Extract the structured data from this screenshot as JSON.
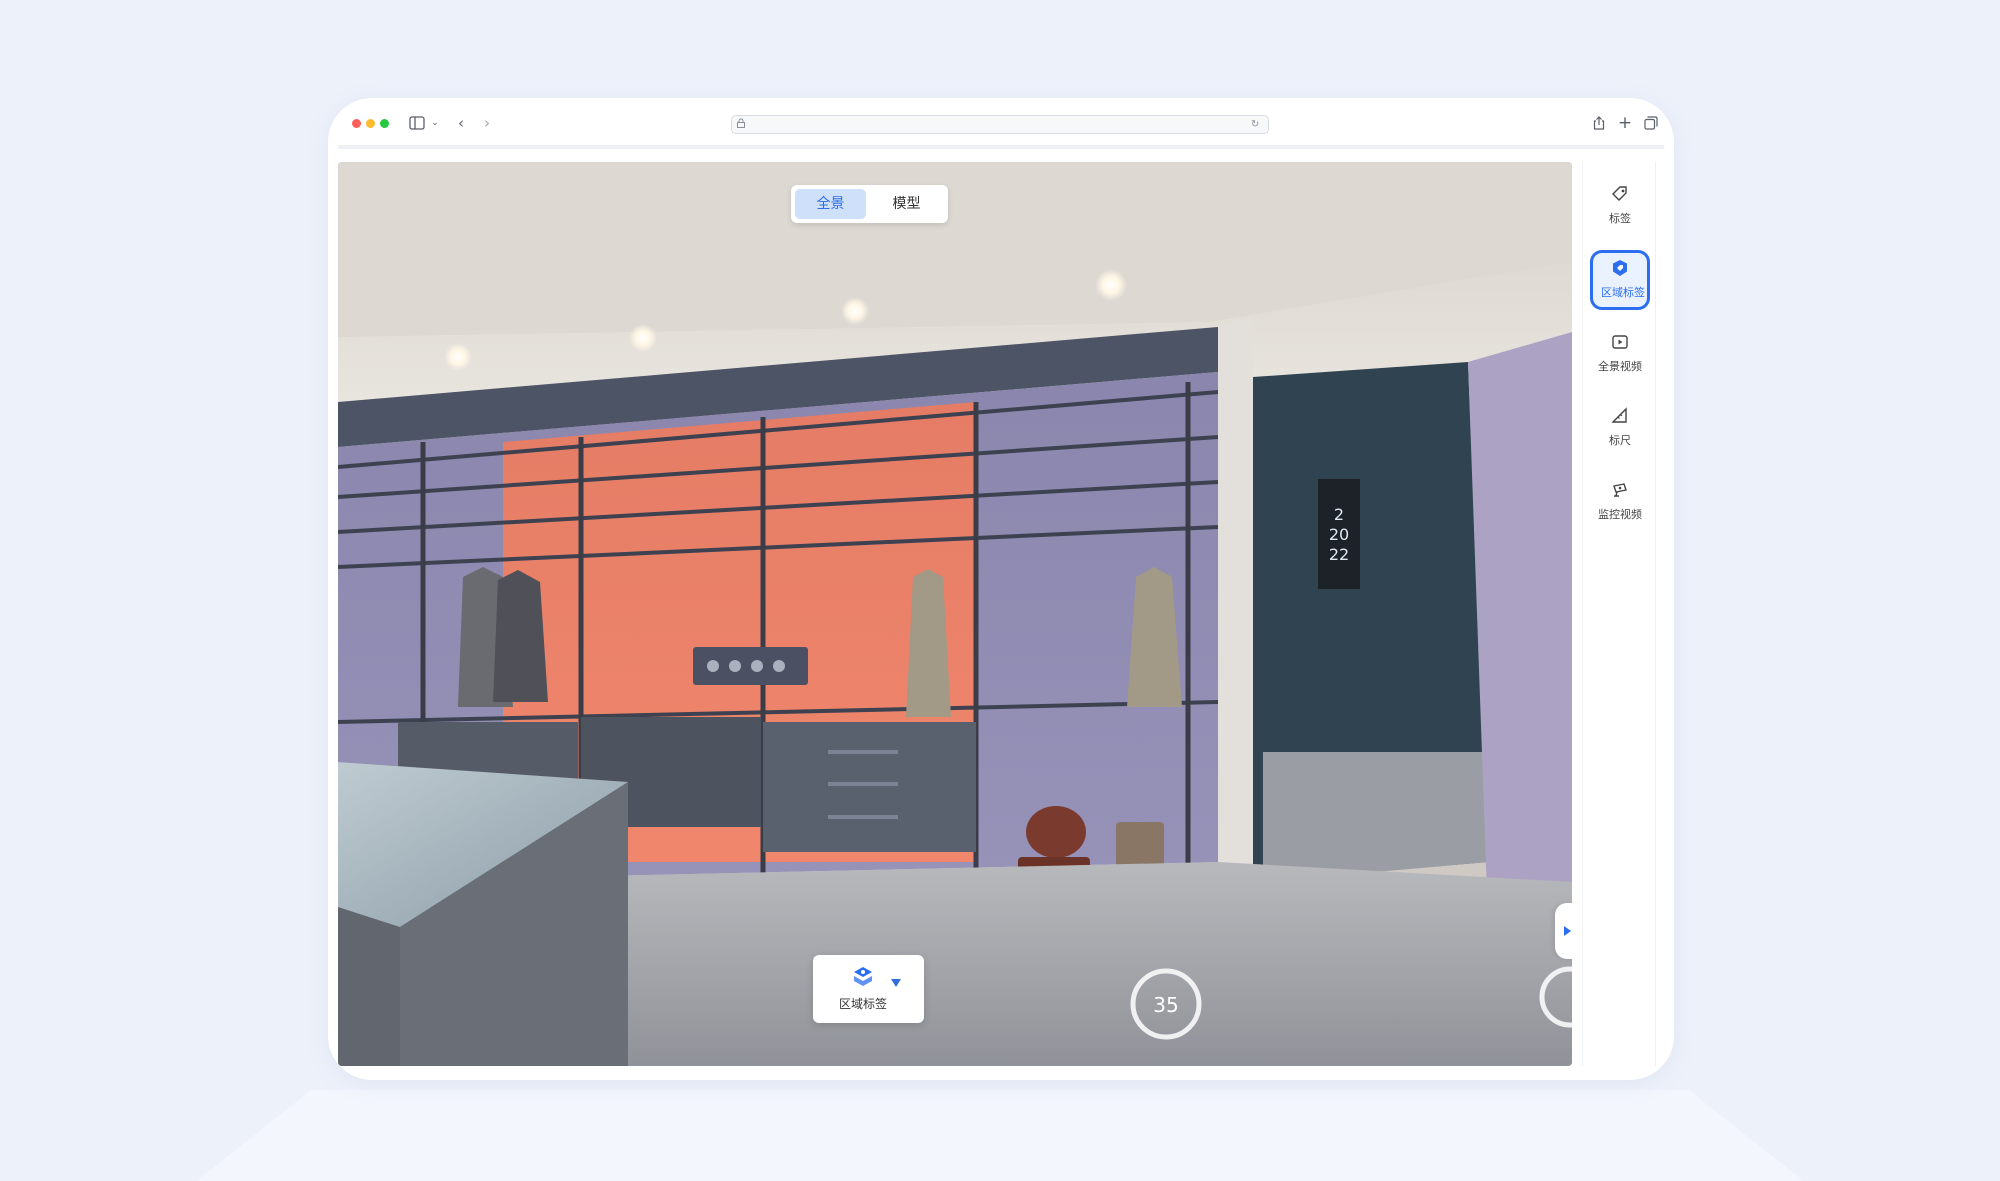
{
  "browser": {
    "icons": [
      "sidebar-icon",
      "chevron-down-icon",
      "back-icon",
      "forward-icon",
      "lock-icon",
      "reload-icon",
      "share-icon",
      "new-tab-icon",
      "tabs-overview-icon"
    ]
  },
  "viewer": {
    "mode_switch": {
      "options": [
        "全景",
        "模型"
      ],
      "active": "全景"
    },
    "scene": {
      "sign_text": [
        "2",
        "20",
        "22"
      ],
      "floor_markers": [
        "35"
      ]
    },
    "area_popup": {
      "label": "区域标签",
      "icon": "area-tag-icon"
    }
  },
  "toolbar": {
    "items": [
      {
        "label": "标签",
        "icon": "tag-icon",
        "active": false
      },
      {
        "label": "区域标签",
        "icon": "area-tag-icon",
        "active": true
      },
      {
        "label": "全景视频",
        "icon": "panorama-video-icon",
        "active": false
      },
      {
        "label": "标尺",
        "icon": "ruler-icon",
        "active": false
      },
      {
        "label": "监控视频",
        "icon": "camera-icon",
        "active": false
      }
    ],
    "accent": "#2b6ef0"
  }
}
